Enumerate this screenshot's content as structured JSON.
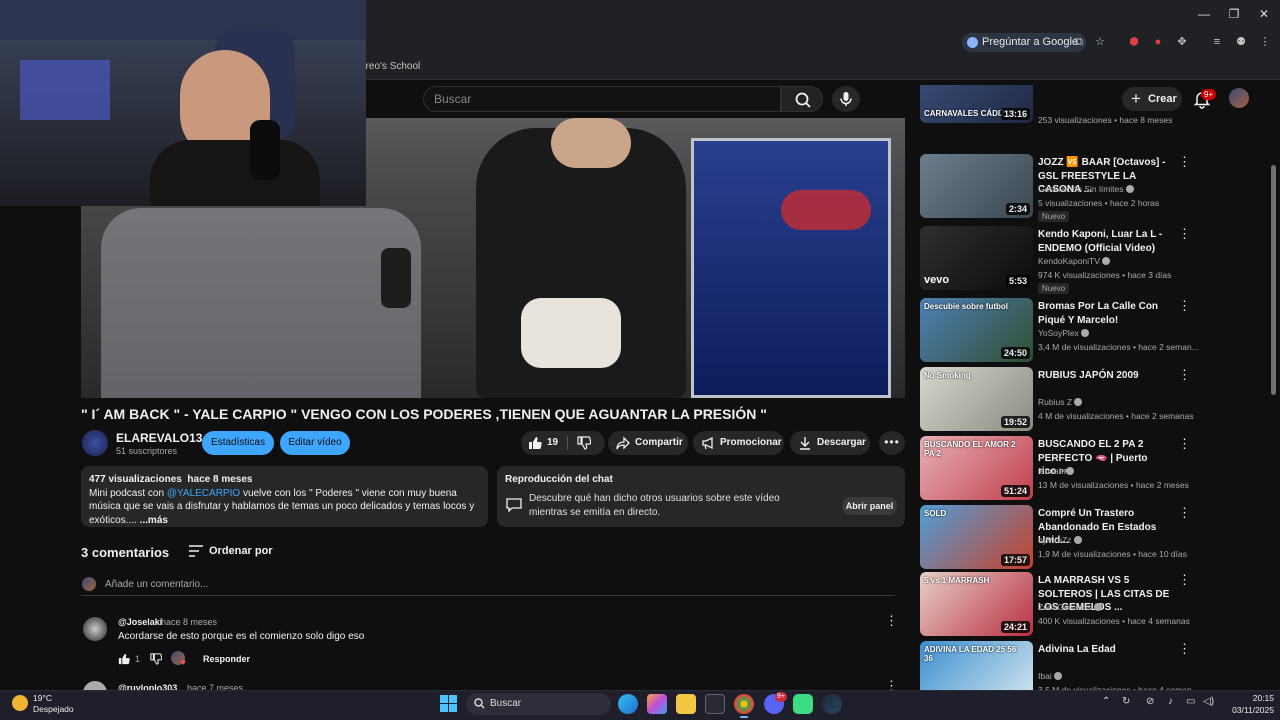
{
  "browser": {
    "bookmark_text": "oreo's School",
    "ask_google_label": "Pregúntar a Google"
  },
  "header": {
    "search_placeholder": "Buscar",
    "create_label": "Crear",
    "notifications_badge": "9+"
  },
  "video": {
    "title": "\" I´ AM BACK \" - YALE CARPIO \" VENGO CON LOS PODERES ,TIENEN QUE AGUANTAR LA PRESIÓN \"",
    "channel_name": "ELAREVALO13",
    "subscribers": "51 suscriptores",
    "stats_button": "Estadísticas",
    "edit_button": "Editar vídeo",
    "likes": "19",
    "share_label": "Compartir",
    "promote_label": "Promocionar",
    "download_label": "Descargar"
  },
  "description": {
    "views": "477 visualizaciones",
    "date": "hace 8 meses",
    "text_before": "Mini podcast con",
    "mention": "@YALECARPIO",
    "text_after": "vuelve con los \" Poderes \" viene con muy buena música que se vais a disfrutar y hablamos de temas un poco delicados y temas locos y exóticos....",
    "more": "...más"
  },
  "chat_replay": {
    "title": "Reproducción del chat",
    "description": "Descubre qué han dicho otros usuarios sobre este vídeo mientras se emitía en directo.",
    "button": "Abrir panel"
  },
  "comments": {
    "count_label": "3 comentarios",
    "sort_label": "Ordenar por",
    "add_placeholder": "Añade un comentario...",
    "items": [
      {
        "author": "@Joselaki",
        "time": "hace 8 meses",
        "text": "Acordarse de esto porque es el comienzo solo digo eso",
        "likes": "1",
        "reply": "Responder"
      },
      {
        "author": "@ruyloplo303",
        "time": "hace 7 meses"
      }
    ]
  },
  "recommendations": [
    {
      "thumb_text": "CARNAVALES CÁDIZ 20",
      "duration": "13:16",
      "meta": "253 visualizaciones • hace 8 meses",
      "colors": [
        "#3a4f7a",
        "#1f2a44"
      ]
    },
    {
      "title": "JOZZ 🆚 BAAR [Octavos] - GSL FREESTYLE LA CASONA ...",
      "channel": "Generación Sin límites",
      "meta": "5 visualizaciones • hace 2 horas",
      "badge": "Nuevo",
      "duration": "2:34",
      "colors": [
        "#6b7e8e",
        "#3b4750"
      ]
    },
    {
      "title": "Kendo Kaponi, Luar La L - ENDEMO (Official Video)",
      "channel": "KendoKaponiTV",
      "meta": "974 K visualizaciones • hace 3 días",
      "badge": "Nuevo",
      "duration": "5:53",
      "thumb_text": "vevo",
      "colors": [
        "#2e2e2e",
        "#0c0c0c"
      ]
    },
    {
      "title": "Bromas Por La Calle Con Piqué Y Marcelo!",
      "channel": "YoSoyPlex",
      "meta": "3,4 M de visualizaciones • hace 2 seman...",
      "duration": "24:50",
      "thumb_text": "Descubie sobre futbol",
      "colors": [
        "#4f7fb8",
        "#2f4f2f"
      ]
    },
    {
      "title": "RUBIUS JAPÓN 2009",
      "channel": "Rubius Z",
      "meta": "4 M de visualizaciones • hace 2 semanas",
      "duration": "19:52",
      "thumb_text": "No Smoking",
      "colors": [
        "#d8d8d0",
        "#8a8a80"
      ]
    },
    {
      "title": "BUSCANDO EL 2 PA 2 PERFECTO 🫦 | Puerto rico",
      "title_suffix": "PR",
      "channel": "lebriah",
      "meta": "13 M de visualizaciones • hace 2 meses",
      "duration": "51:24",
      "thumb_text": "BUSCANDO EL AMOR 2 PA 2",
      "colors": [
        "#e8b0b8",
        "#c0404a"
      ]
    },
    {
      "title": "Compré Un Trastero Abandonado En Estados Unid...",
      "channel": "byViruZz",
      "meta": "1,9 M de visualizaciones • hace 10 días",
      "duration": "17:57",
      "thumb_text": "SOLD",
      "colors": [
        "#4f9fd8",
        "#c8402a"
      ]
    },
    {
      "title": "LA MARRASH VS 5 SOLTEROS | LAS CITAS DE LOS GEMELOS ...",
      "channel": "ZonaGemelos",
      "meta": "400 K visualizaciones • hace 4 semanas",
      "duration": "24:21",
      "thumb_text": "5 vs 1 MARRASH",
      "colors": [
        "#e8d0c8",
        "#b83040"
      ]
    },
    {
      "title": "Adivina La Edad",
      "channel": "Ibai",
      "meta": "3,5 M de visualizaciones • hace 4 seman...",
      "thumb_text": "ADIVINA LA EDAD 25 56 36",
      "colors": [
        "#3a8fd0",
        "#d8e8f0"
      ]
    }
  ],
  "taskbar": {
    "temperature": "19°C",
    "weather": "Despejado",
    "search_label": "Buscar",
    "time": "20:15",
    "date": "03/11/2025",
    "discord_badge": "9+"
  }
}
